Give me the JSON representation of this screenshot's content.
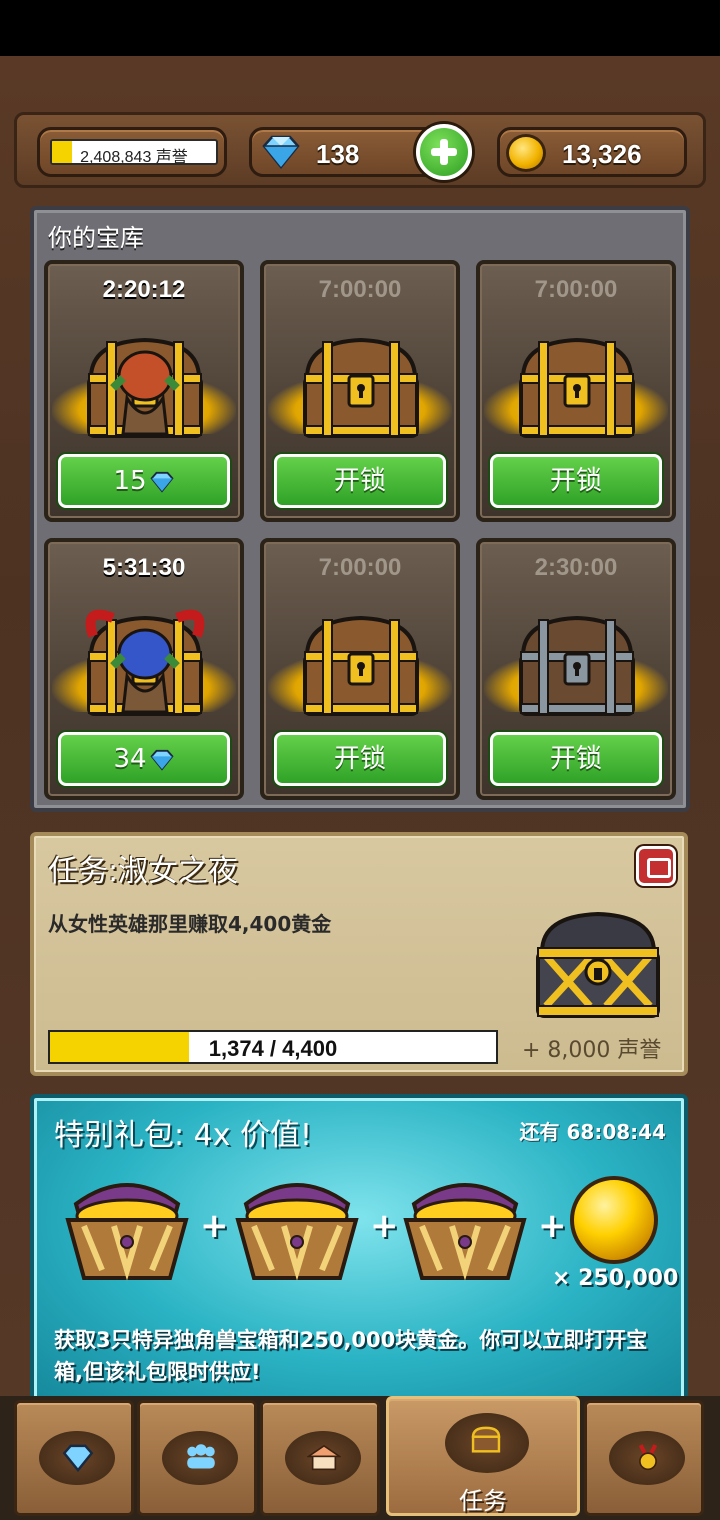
{
  "header": {
    "reputation_text": "2,408,843 声誉",
    "reputation_fill": 0.12,
    "gems": "138",
    "gold": "13,326"
  },
  "vault": {
    "title": "你的宝库",
    "slots": [
      {
        "timer": "2:20:12",
        "button": "15",
        "button_type": "gems",
        "chest": "goblin-red",
        "active": true
      },
      {
        "timer": "7:00:00",
        "button": "开锁",
        "button_type": "unlock",
        "chest": "wooden",
        "active": false
      },
      {
        "timer": "7:00:00",
        "button": "开锁",
        "button_type": "unlock",
        "chest": "wooden",
        "active": false
      },
      {
        "timer": "5:31:30",
        "button": "34",
        "button_type": "gems",
        "chest": "goblin-blue-horned",
        "active": true
      },
      {
        "timer": "7:00:00",
        "button": "开锁",
        "button_type": "unlock",
        "chest": "wooden",
        "active": false
      },
      {
        "timer": "2:30:00",
        "button": "开锁",
        "button_type": "unlock",
        "chest": "iron",
        "active": false
      }
    ]
  },
  "quest": {
    "title": "任务:淑女之夜",
    "description": "从女性英雄那里赚取4,400黄金",
    "progress_text": "1,374 / 4,400",
    "progress_fraction": 0.312,
    "reward": "+ 8,000 声誉"
  },
  "offer": {
    "title": "特别礼包: 4x 价值!",
    "timer": "还有 68:08:44",
    "multiplier": "× 250,000",
    "description": "获取3只特异独角兽宝箱和250,000块黄金。你可以立即打开宝箱,但该礼包限时供应!"
  },
  "nav": {
    "tabs": [
      {
        "icon": "gem-icon",
        "label": ""
      },
      {
        "icon": "heroes-icon",
        "label": ""
      },
      {
        "icon": "buildings-icon",
        "label": ""
      },
      {
        "icon": "chest-icon",
        "label": "任务"
      },
      {
        "icon": "medal-icon",
        "label": ""
      }
    ]
  },
  "colors": {
    "green_button": "#3fb532",
    "progress_yellow": "#f5d300",
    "offer_teal": "#2ab3c4"
  }
}
